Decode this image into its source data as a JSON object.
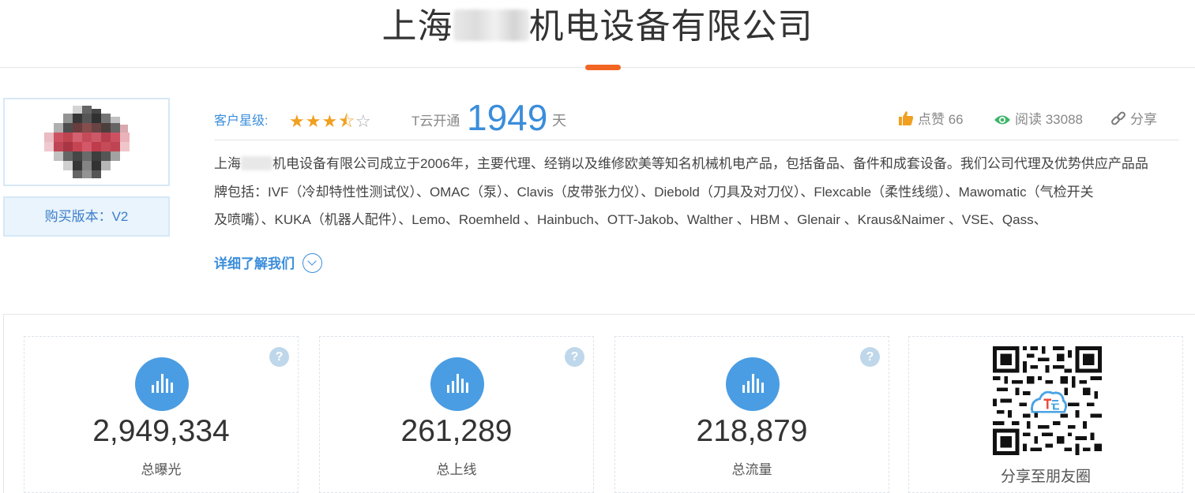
{
  "company": {
    "title_prefix": "上海",
    "title_suffix": "机电设备有限公司"
  },
  "sidebar": {
    "version_label": "购买版本：V2"
  },
  "info": {
    "star_label": "客户星级:",
    "star_rating": 3.5,
    "star_max": 5,
    "tyun_label": "T云开通",
    "days": "1949",
    "days_unit": "天",
    "likes_label": "点赞 66",
    "reads_label": "阅读 33088",
    "share_label": "分享"
  },
  "description": {
    "line1_prefix": "上海",
    "line1_rest": "机电设备有限公司成立于2006年，主要代理、经销以及维修欧美等知名机械机电产品，包括备品、备件和成套设备。我们公司代理及优势供应产品品",
    "line2": "牌包括：IVF（冷却特性性测试仪）、OMAC（泵）、Clavis（皮带张力仪）、Diebold（刀具及对刀仪）、Flexcable（柔性线缆）、Mawomatic（气检开关",
    "line3": "及喷嘴）、KUKA（机器人配件）、Lemo、Roemheld 、Hainbuch、OTT-Jakob、Walther 、HBM 、Glenair 、Kraus&Naimer 、VSE、Qass、",
    "more_label": "详细了解我们"
  },
  "stats": [
    {
      "value": "2,949,334",
      "label": "总曝光",
      "help": "?"
    },
    {
      "value": "261,289",
      "label": "总上线",
      "help": "?"
    },
    {
      "value": "218,879",
      "label": "总流量",
      "help": "?"
    }
  ],
  "qr": {
    "label": "分享至朋友圈"
  },
  "colors": {
    "accent": "#3a8ddb",
    "orange": "#f26522",
    "star": "#f0a020",
    "stat_circle": "#4a9de3"
  }
}
